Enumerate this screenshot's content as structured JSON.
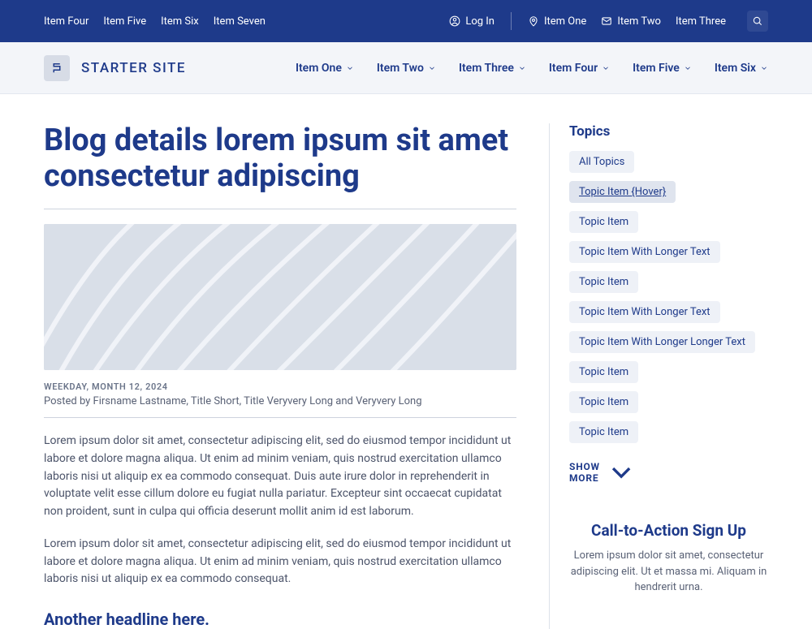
{
  "topbar": {
    "left_links": [
      "Item Four",
      "Item Five",
      "Item Six",
      "Item Seven"
    ],
    "login": "Log In",
    "right_links": [
      "Item One",
      "Item Two",
      "Item Three"
    ]
  },
  "brand": {
    "name": "STARTER SITE"
  },
  "nav": {
    "items": [
      "Item One",
      "Item Two",
      "Item Three",
      "Item Four",
      "Item Five",
      "Item Six"
    ]
  },
  "article": {
    "title": "Blog details lorem ipsum sit amet consectetur adipiscing",
    "date": "WEEKDAY, MONTH 12, 2024",
    "byline": "Posted by Firsname Lastname, Title Short, Title Veryvery Long and Veryvery Long",
    "para1": "Lorem ipsum dolor sit amet, consectetur adipiscing elit, sed do eiusmod tempor incididunt ut labore et dolore magna aliqua. Ut enim ad minim veniam, quis nostrud exercitation ullamco laboris nisi ut aliquip ex ea commodo consequat. Duis aute irure dolor in reprehenderit in voluptate velit esse cillum dolore eu fugiat nulla pariatur. Excepteur sint occaecat cupidatat non proident, sunt in culpa qui officia deserunt mollit anim id est laborum.",
    "para2": "Lorem ipsum dolor sit amet, consectetur adipiscing elit, sed do eiusmod tempor incididunt ut labore et dolore magna aliqua. Ut enim ad minim veniam, quis nostrud exercitation ullamco laboris nisi ut aliquip ex ea commodo consequat.",
    "subhead": "Another headline here."
  },
  "sidebar": {
    "heading": "Topics",
    "tags": [
      {
        "label": "All Topics",
        "hovered": false
      },
      {
        "label": "Topic Item {Hover}",
        "hovered": true
      },
      {
        "label": "Topic Item",
        "hovered": false
      },
      {
        "label": "Topic Item With Longer Text",
        "hovered": false
      },
      {
        "label": "Topic Item",
        "hovered": false
      },
      {
        "label": "Topic Item With Longer Text",
        "hovered": false
      },
      {
        "label": "Topic Item With Longer Longer Text",
        "hovered": false
      },
      {
        "label": "Topic Item",
        "hovered": false
      },
      {
        "label": "Topic Item",
        "hovered": false
      },
      {
        "label": "Topic Item",
        "hovered": false
      }
    ],
    "show_more": "SHOW MORE",
    "cta_heading": "Call-to-Action Sign Up",
    "cta_text": "Lorem ipsum dolor sit amet, consectetur adipiscing elit. Ut et massa mi. Aliquam in hendrerit urna."
  }
}
